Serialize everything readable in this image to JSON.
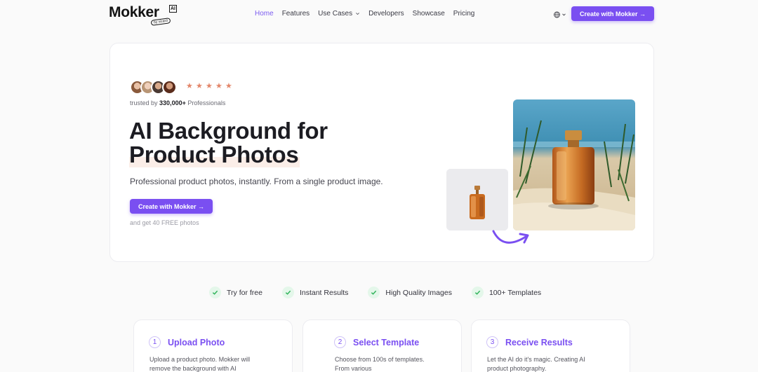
{
  "brand": {
    "name": "Mokker",
    "badge": "AI",
    "byline": "by vizard"
  },
  "nav": {
    "items": [
      {
        "label": "Home",
        "active": true
      },
      {
        "label": "Features"
      },
      {
        "label": "Use Cases",
        "has_dropdown": true
      },
      {
        "label": "Developers"
      },
      {
        "label": "Showcase"
      },
      {
        "label": "Pricing"
      }
    ],
    "cta": "Create with Mokker →"
  },
  "hero": {
    "rating_stars": 5,
    "trusted_prefix": "trusted by",
    "trusted_count": "330,000+",
    "trusted_suffix": "Professionals",
    "headline_line1": "AI Background for",
    "headline_line2": "Product Photos",
    "subtitle": "Professional product photos, instantly. From a single product image.",
    "cta": "Create with Mokker →",
    "note": "and get 40 FREE photos"
  },
  "features": [
    "Try for free",
    "Instant Results",
    "High Quality Images",
    "100+ Templates"
  ],
  "steps": [
    {
      "num": "1",
      "title": "Upload Photo",
      "desc": "Upload a product photo. Mokker will remove the background with AI"
    },
    {
      "num": "2",
      "title": "Select Template",
      "desc": "Choose from 100s of templates. From various"
    },
    {
      "num": "3",
      "title": "Receive Results",
      "desc": "Let the AI do it's magic. Creating AI product photography."
    }
  ],
  "colors": {
    "accent": "#7a4ff1",
    "star": "#e3866a",
    "check_bg": "#e4f7ea",
    "check": "#2fb35a"
  },
  "icons": {
    "globe": "globe-icon",
    "dropdown": "chevron-down-icon",
    "check": "check-icon",
    "arrow": "curved-arrow-icon"
  }
}
